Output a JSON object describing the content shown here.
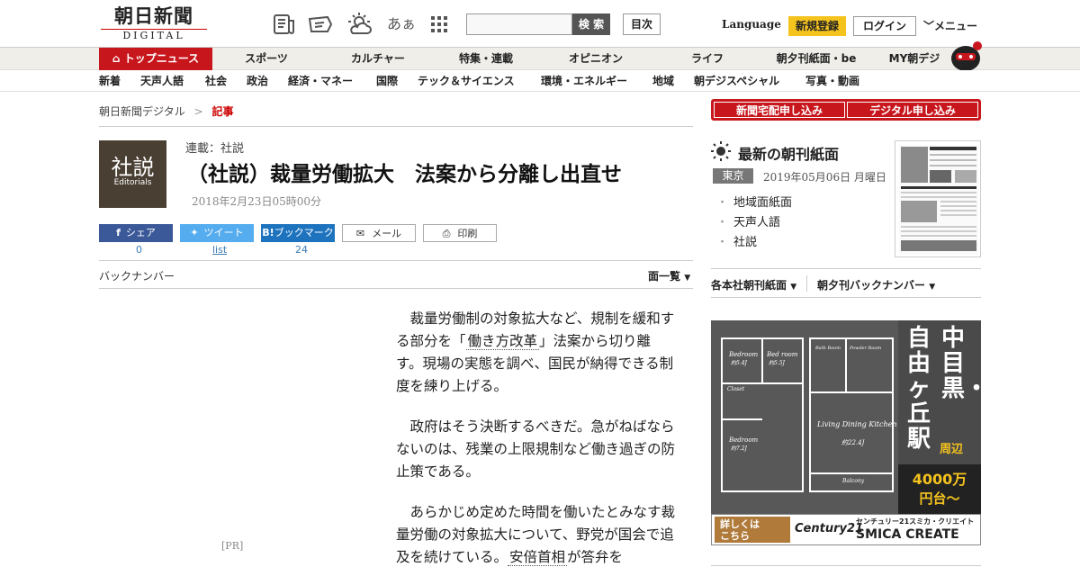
{
  "header": {
    "logo_jp": "朝日新聞",
    "logo_en": "DIGITAL",
    "search_button": "検 索",
    "index_button": "目次",
    "language": "Language",
    "register": "新規登録",
    "login": "ログイン",
    "menu": "メニュー",
    "icons": [
      "newspaper-icon",
      "coupon-icon",
      "weather-icon",
      "font-size-icon",
      "apps-grid-icon"
    ],
    "font_icon_text": "あぁ"
  },
  "nav_primary": {
    "top": "トップニュース",
    "items": [
      "スポーツ",
      "カルチャー",
      "特集・連載",
      "オピニオン",
      "ライフ",
      "朝夕刊紙面・be",
      "MY朝デジ"
    ]
  },
  "nav_secondary": {
    "items": [
      "新着",
      "天声人語",
      "社会",
      "政治",
      "経済・マネー",
      "国際",
      "テック＆サイエンス",
      "環境・エネルギー",
      "地域",
      "朝デジスペシャル",
      "写真・動画"
    ]
  },
  "breadcrumb": {
    "home": "朝日新聞デジタル",
    "separator": ">",
    "current": "記事"
  },
  "article": {
    "thumb_jp": "社説",
    "thumb_en": "Editorials",
    "series": "連載：社説",
    "title": "（社説）裁量労働拡大　法案から分離し出直せ",
    "date": "2018年2月23日05時00分",
    "share": {
      "facebook": "シェア",
      "facebook_count": "0",
      "twitter": "ツイート",
      "twitter_count": "list",
      "hatena": "ブックマーク",
      "hatena_logo": "B!",
      "hatena_count": "24",
      "mail": "メール",
      "print": "印刷"
    },
    "back_number": "バックナンバー",
    "list_menu": "面一覧",
    "pr_label": "[PR]",
    "paragraphs": [
      {
        "pre": "裁量労働制の対象拡大など、規制を緩和する部分を「",
        "link": "働き方改革",
        "post": "」法案から切り離す。現場の実態を調べ、国民が納得できる制度を練り上げる。"
      },
      {
        "pre": "政府はそう決断するべきだ。急がねばならないのは、残業の上限規制など働き過ぎの防止策である。",
        "link": "",
        "post": ""
      },
      {
        "pre": "あらかじめ定めた時間を働いたとみなす裁量労働の対象拡大について、野党が国会で追及を続けている。",
        "link": "安倍首相",
        "post": "が答弁を"
      }
    ]
  },
  "sidebar": {
    "subscribe_paper": "新聞宅配申し込み",
    "subscribe_digital": "デジタル申し込み",
    "latest_title": "最新の朝刊紙面",
    "region": "東京",
    "paper_date": "2019年05月06日 月曜日",
    "links": [
      "地域面紙面",
      "天声人語",
      "社説"
    ],
    "honsha": "各本社朝刊紙面",
    "back_number": "朝夕刊バックナンバー",
    "ad": {
      "headline": [
        "中目黒・",
        "周辺"
      ],
      "headline2": [
        "自由ヶ丘駅"
      ],
      "price": [
        "4000万",
        "円台〜"
      ],
      "cta": [
        "詳しくは",
        "こちら"
      ],
      "brand": "センチュリー21スミカ・クリエイト",
      "brand_en": "SMICA CREATE",
      "century": "Century21",
      "rooms": [
        "Bedroom",
        "Bed room",
        "Bath Room",
        "Powder Room",
        "Closet",
        "Living Dining Kitchen",
        "Balcony"
      ],
      "room_sizes": [
        "約5.4J",
        "約5.5J",
        "約7.2J",
        "約22.4J"
      ]
    }
  },
  "colors": {
    "brand_red": "#c8161d",
    "register_yellow": "#f5c31e",
    "facebook": "#3b5998",
    "twitter": "#55acee",
    "hatena": "#1e73be"
  }
}
